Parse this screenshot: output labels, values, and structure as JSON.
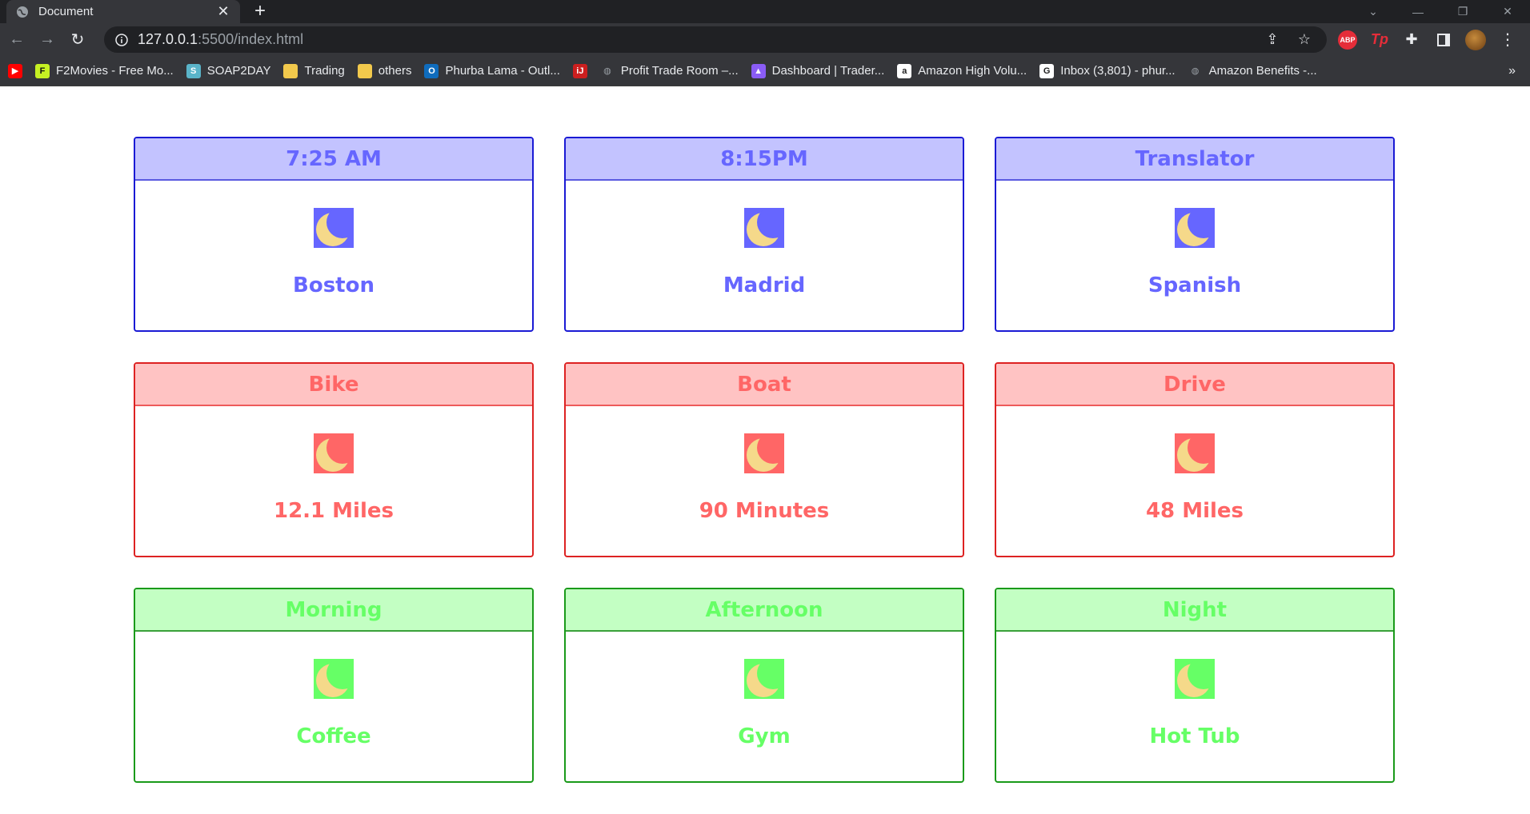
{
  "browser": {
    "tab_title": "Document",
    "url_host": "127.0.0.1",
    "url_rest": ":5500/index.html",
    "bookmarks": [
      {
        "label": "",
        "icon": "youtube-icon",
        "color": "#ff0000"
      },
      {
        "label": "F2Movies - Free Mo...",
        "icon": "f2movies-icon",
        "color": "#c6f123"
      },
      {
        "label": "SOAP2DAY",
        "icon": "soap2day-icon",
        "color": "#5ab4c9"
      },
      {
        "label": "Trading",
        "icon": "folder-icon",
        "color": "#f2c94c"
      },
      {
        "label": "others",
        "icon": "folder-icon",
        "color": "#f2c94c"
      },
      {
        "label": "Phurba Lama - Outl...",
        "icon": "outlook-icon",
        "color": "#0f6cbd"
      },
      {
        "label": "",
        "icon": "red-bookmark-icon",
        "color": "#cc1f1f"
      },
      {
        "label": "Profit Trade Room –...",
        "icon": "globe-icon",
        "color": "#9aa0a6"
      },
      {
        "label": "Dashboard | Trader...",
        "icon": "trader-icon",
        "color": "#8a5cf6"
      },
      {
        "label": "Amazon High Volu...",
        "icon": "amazon-icon",
        "color": "#ffffff"
      },
      {
        "label": "Inbox (3,801) - phur...",
        "icon": "google-icon",
        "color": "#ffffff"
      },
      {
        "label": "Amazon Benefits -...",
        "icon": "globe-icon",
        "color": "#9aa0a6"
      }
    ],
    "more_bookmarks": "»",
    "ext_abp": "ABP",
    "ext_tp": "Tp"
  },
  "colors": {
    "blue": "#6666ff",
    "red": "#ff6666",
    "green": "#66ff66",
    "moon": "#f5d98a"
  },
  "rows": [
    {
      "theme": "blue",
      "cards": [
        {
          "header": "7:25 AM",
          "text": "Boston",
          "icon": "moon-icon"
        },
        {
          "header": "8:15PM",
          "text": "Madrid",
          "icon": "moon-icon"
        },
        {
          "header": "Translator",
          "text": "Spanish",
          "icon": "moon-icon"
        }
      ]
    },
    {
      "theme": "red",
      "cards": [
        {
          "header": "Bike",
          "text": "12.1 Miles",
          "icon": "moon-icon"
        },
        {
          "header": "Boat",
          "text": "90 Minutes",
          "icon": "moon-icon"
        },
        {
          "header": "Drive",
          "text": "48 Miles",
          "icon": "moon-icon"
        }
      ]
    },
    {
      "theme": "green",
      "cards": [
        {
          "header": "Morning",
          "text": "Coffee",
          "icon": "moon-icon"
        },
        {
          "header": "Afternoon",
          "text": "Gym",
          "icon": "moon-icon"
        },
        {
          "header": "Night",
          "text": "Hot Tub",
          "icon": "moon-icon"
        }
      ]
    }
  ]
}
